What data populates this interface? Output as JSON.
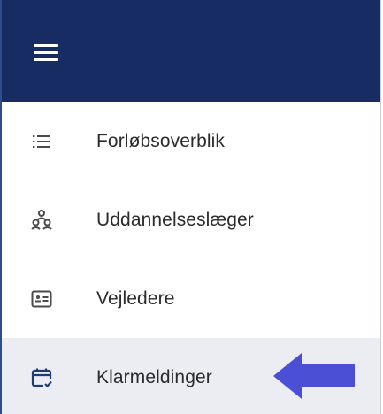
{
  "menu": {
    "toggle_icon": "hamburger-menu-icon",
    "items": [
      {
        "label": "Forløbsoverblik",
        "icon": "list-icon",
        "active": false
      },
      {
        "label": "Uddannelseslæger",
        "icon": "users-icon",
        "active": false
      },
      {
        "label": "Vejledere",
        "icon": "id-card-icon",
        "active": false
      },
      {
        "label": "Klarmeldinger",
        "icon": "calendar-check-icon",
        "active": true
      }
    ]
  },
  "colors": {
    "topbar": "#172c62",
    "active_bg": "#ebedf2",
    "arrow": "#4a4fd6"
  }
}
